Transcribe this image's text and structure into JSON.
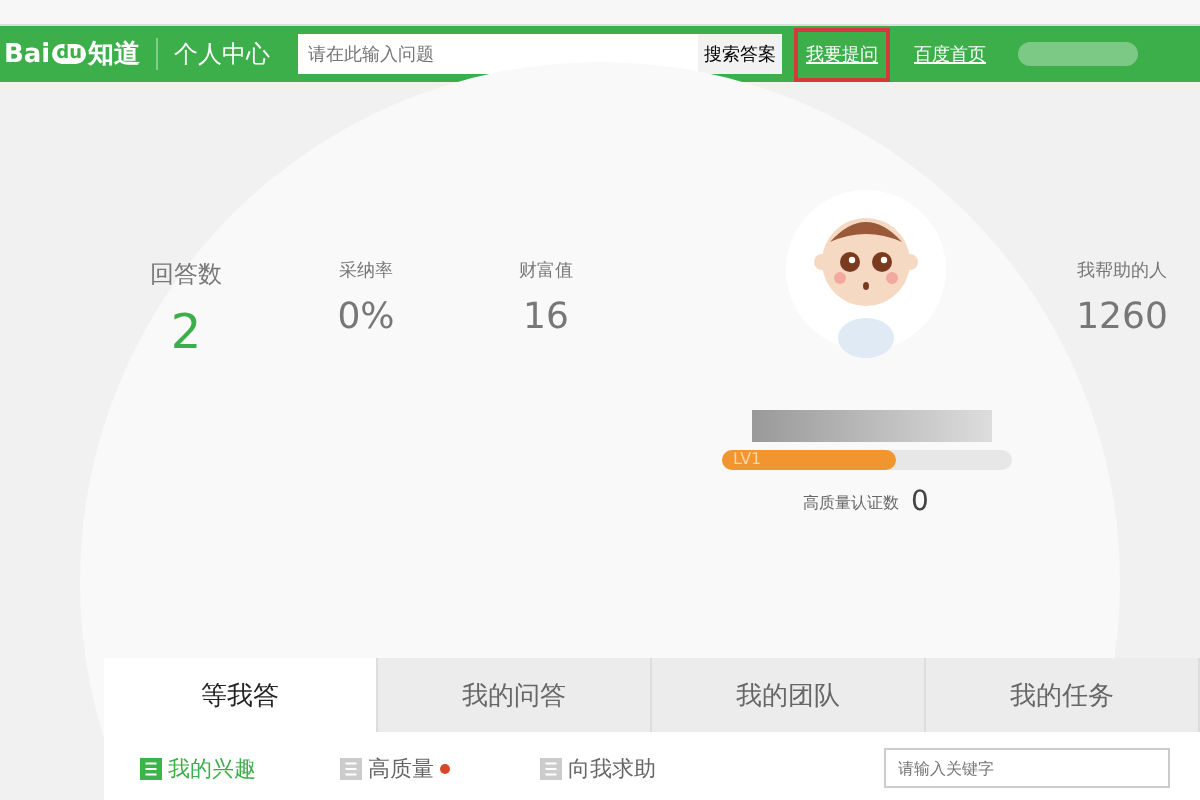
{
  "header": {
    "logo": {
      "left": "Bai",
      "paw": "du",
      "right": "知道"
    },
    "section": "个人中心",
    "search": {
      "placeholder": "请在此输入问题",
      "button": "搜索答案"
    },
    "links": [
      {
        "label": "我要提问",
        "highlighted": true
      },
      {
        "label": "百度首页",
        "highlighted": false
      }
    ]
  },
  "stats": [
    {
      "label": "回答数",
      "value": "2",
      "primary": true
    },
    {
      "label": "采纳率",
      "value": "0%",
      "primary": false
    },
    {
      "label": "财富值",
      "value": "16",
      "primary": false
    },
    {
      "label": "我帮助的人",
      "value": "1260",
      "primary": false
    }
  ],
  "profile": {
    "level_label": "LV1",
    "level": 0.6,
    "cert_label": "高质量认证数",
    "cert_count": "0"
  },
  "tabs": [
    {
      "label": "等我答",
      "selected": true
    },
    {
      "label": "我的问答",
      "selected": false
    },
    {
      "label": "我的团队",
      "selected": false
    },
    {
      "label": "我的任务",
      "selected": false
    }
  ],
  "subtabs": [
    {
      "label": "我的兴趣",
      "selected": true,
      "dot": false
    },
    {
      "label": "高质量",
      "selected": false,
      "dot": true
    },
    {
      "label": "向我求助",
      "selected": false,
      "dot": false
    }
  ],
  "keyword_search": {
    "placeholder": "请输入关键字"
  }
}
